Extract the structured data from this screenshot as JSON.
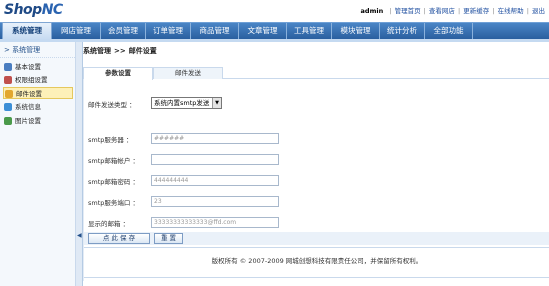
{
  "header": {
    "logo": {
      "brand": "Shop",
      "suffix": "NC"
    },
    "user": "admin",
    "links": [
      "管理首页",
      "查看网店",
      "更新缓存",
      "在线帮助",
      "退出"
    ]
  },
  "nav": {
    "tabs": [
      "系统管理",
      "网店管理",
      "会员管理",
      "订单管理",
      "商品管理",
      "文章管理",
      "工具管理",
      "模块管理",
      "统计分析",
      "全部功能"
    ],
    "active_index": 0
  },
  "sidebar": {
    "title": "系统管理",
    "items": [
      {
        "label": "基本设置",
        "icon": "gear-icon",
        "color": "#4a7dc0"
      },
      {
        "label": "权限组设置",
        "icon": "users-icon",
        "color": "#c0504d"
      },
      {
        "label": "邮件设置",
        "icon": "envelope-icon",
        "color": "#e2a72e"
      },
      {
        "label": "系统信息",
        "icon": "info-icon",
        "color": "#3d8fd6"
      },
      {
        "label": "图片设置",
        "icon": "image-icon",
        "color": "#4a9a4a"
      }
    ],
    "active_index": 2
  },
  "main": {
    "breadcrumb": {
      "section": "系统管理",
      "separator": ">>",
      "page": "邮件设置"
    },
    "tabs": [
      "参数设置",
      "邮件发送"
    ],
    "active_tab": 0,
    "form": {
      "send_type": {
        "label": "邮件发送类型 ：",
        "value": "系统内置smtp发送"
      },
      "smtp_server": {
        "label": "smtp服务器 ：",
        "value": "######"
      },
      "smtp_account": {
        "label": "smtp邮箱帐户 ：",
        "value": ""
      },
      "smtp_password": {
        "label": "smtp邮箱密码 ：",
        "value": "444444444"
      },
      "smtp_port": {
        "label": "smtp服务端口 ：",
        "value": "23"
      },
      "display_email": {
        "label": "显示的邮箱 ：",
        "value": "33333333333333@ffd.com"
      }
    },
    "buttons": {
      "save": "点 此 保 存",
      "reset": "重 置"
    },
    "footer": "版权所有 © 2007-2009 网城创想科技有限责任公司，并保留所有权利。"
  },
  "colors": {
    "nav_blue": "#2a5f9f",
    "active_highlight": "#fdf0b8"
  }
}
